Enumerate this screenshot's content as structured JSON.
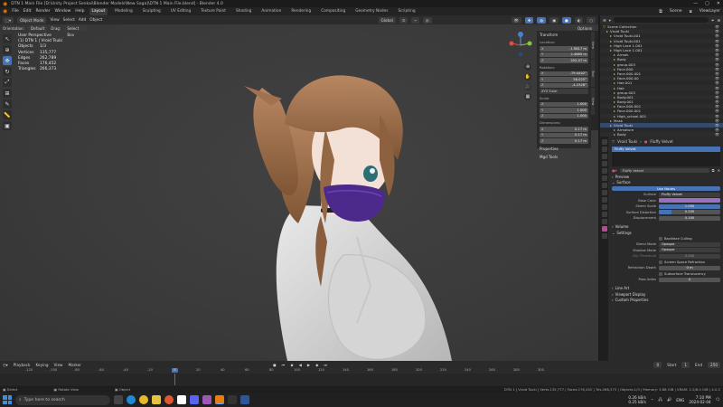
{
  "window": {
    "title": "DTN 1 Main File [D:\\Unity Project Senkai\\Blender Models\\New Saga]\\DTN 1 Main File.blend] - Blender 4.0"
  },
  "menubar": {
    "menus": [
      "File",
      "Edit",
      "Render",
      "Window",
      "Help"
    ],
    "workspaces": [
      "Layout",
      "Modeling",
      "Sculpting",
      "UV Editing",
      "Texture Paint",
      "Shading",
      "Animation",
      "Rendering",
      "Compositing",
      "Geometry Nodes",
      "Scripting"
    ],
    "active_workspace": "Layout",
    "scene_label": "Scene",
    "view_layer_label": "ViewLayer"
  },
  "viewport_header": {
    "mode": "Object Mode",
    "menus": [
      "View",
      "Select",
      "Add",
      "Object"
    ],
    "transform": "Global",
    "orientation_label": "Orientation:",
    "orientation_value": "Default",
    "drag_label": "Drag:",
    "drag_value": "Select Box",
    "options_label": "Options"
  },
  "viewport_overlay": {
    "view_name": "User Perspective",
    "collection": "(1) DTN 1 | Vroid Tsuki",
    "stats": [
      {
        "k": "Objects",
        "v": "1/3"
      },
      {
        "k": "Vertices",
        "v": "135,777"
      },
      {
        "k": "Edges",
        "v": "262,789"
      },
      {
        "k": "Faces",
        "v": "176,452"
      },
      {
        "k": "Triangles",
        "v": "266,373"
      }
    ]
  },
  "npanel": {
    "title": "Transform",
    "location_label": "Location:",
    "location": [
      {
        "ax": "X",
        "v": "-1.9817 m"
      },
      {
        "ax": "Y",
        "v": "2.4685 m"
      },
      {
        "ax": "Z",
        "v": "202.47 m"
      }
    ],
    "rotation_label": "Rotation:",
    "rotation": [
      {
        "ax": "X",
        "v": "-79.4442°"
      },
      {
        "ax": "Y",
        "v": "58.025°"
      },
      {
        "ax": "Z",
        "v": "-4.2328°"
      }
    ],
    "rotation_mode": "XYZ Euler",
    "scale_label": "Scale:",
    "scale": [
      {
        "ax": "X",
        "v": "1.000"
      },
      {
        "ax": "Y",
        "v": "1.000"
      },
      {
        "ax": "Z",
        "v": "1.000"
      }
    ],
    "dimensions_label": "Dimensions:",
    "dimensions": [
      {
        "ax": "X",
        "v": "0.17 m"
      },
      {
        "ax": "Y",
        "v": "0.17 m"
      },
      {
        "ax": "Z",
        "v": "0.17 m"
      }
    ],
    "properties_label": "Properties",
    "mmd_label": "Mgd Tools",
    "tabs": [
      "Item",
      "Tool",
      "View"
    ]
  },
  "outliner": {
    "search_placeholder": "",
    "rows": [
      {
        "icon": "▽",
        "label": "Scene Collection"
      },
      {
        "icon": "▸",
        "label": "Vroid Tsuki"
      },
      {
        "icon": "▸",
        "label": "Vroid Tsuki.001"
      },
      {
        "icon": "▸",
        "label": "Vroid Tsuki.001"
      },
      {
        "icon": "▸",
        "label": "High Lace 1.001"
      },
      {
        "icon": "▸",
        "label": "High Lace 1.001"
      },
      {
        "icon": "▸",
        "label": "Armat."
      },
      {
        "icon": "▸",
        "label": "Body"
      },
      {
        "icon": "▸",
        "label": "group.003"
      },
      {
        "icon": "▸",
        "label": "Face.000"
      },
      {
        "icon": "▸",
        "label": "Face.000.001"
      },
      {
        "icon": "▸",
        "label": "Face.000.00"
      },
      {
        "icon": "▸",
        "label": "Hair.001"
      },
      {
        "icon": "▸",
        "label": "Hair"
      },
      {
        "icon": "▸",
        "label": "group.003"
      },
      {
        "icon": "▸",
        "label": "Body.001"
      },
      {
        "icon": "▸",
        "label": "Body.001"
      },
      {
        "icon": "▸",
        "label": "Face.000.001"
      },
      {
        "icon": "▸",
        "label": "Face.000.001"
      },
      {
        "icon": "▸",
        "label": "High_school.001"
      },
      {
        "icon": "▸",
        "label": "Mask"
      },
      {
        "icon": "▸",
        "label": "Vroid Tsuki"
      },
      {
        "icon": "▸",
        "label": "Armature"
      },
      {
        "icon": "▸",
        "label": "Body"
      }
    ]
  },
  "properties": {
    "breadcrumb": [
      "Vroid Tsuki",
      "Fluffy Velvet"
    ],
    "slot": "Fluffy Velvet",
    "material_name": "Fluffy Velvet",
    "preview_label": "Preview",
    "surface_section": "Surface",
    "use_nodes": "Use Nodes",
    "surface_label": "Surface",
    "surface_value": "Fluffy Velvet",
    "fields": [
      {
        "l": "Base Color",
        "v": "",
        "color": "#9a6ec0"
      },
      {
        "l": "Sheen Scale",
        "v": "1.000",
        "fill": 1.0
      },
      {
        "l": "Surface Distortion",
        "v": "0.200",
        "fill": 0.2
      },
      {
        "l": "Displacement",
        "v": "0.100",
        "fill": 0.0
      }
    ],
    "volume_section": "Volume",
    "settings_section": "Settings",
    "backface_culling": "Backface Culling",
    "blend_mode_label": "Blend Mode",
    "blend_mode": "Opaque",
    "shadow_mode_label": "Shadow Mode",
    "shadow_mode": "Opaque",
    "clip_threshold_label": "Clip Threshold",
    "clip_threshold": "0.500",
    "screen_space": "Screen Space Refraction",
    "refraction_depth_label": "Refraction Depth",
    "refraction_depth": "0 m",
    "subsurface": "Subsurface Translucency",
    "pass_index_label": "Pass Index",
    "pass_index": "0",
    "line_art": "Line Art",
    "viewport_display": "Viewport Display",
    "custom_props": "Custom Properties"
  },
  "timeline": {
    "menus": [
      "Playback",
      "Keying",
      "View",
      "Marker"
    ],
    "current_frame": "0",
    "start_label": "Start",
    "start": "1",
    "end_label": "End",
    "end": "250",
    "ticks": [
      "-120",
      "-100",
      "-80",
      "-60",
      "-40",
      "-20",
      "0",
      "20",
      "40",
      "60",
      "80",
      "100",
      "120",
      "140",
      "160",
      "180",
      "200",
      "220",
      "240",
      "260",
      "280",
      "300"
    ]
  },
  "statusbar": {
    "left": "Select",
    "middle": "Rotate View",
    "center": "Object",
    "right": "DTN 1 | Vroid Tsuki | Verts:135,777 | Faces:176,452 | Tris:266,373 | Objects:1/3 | Memory: 3.88 GiB | VRAM: 2.2/8.0 GiB | 4.0.2"
  },
  "taskbar": {
    "search_placeholder": "Type here to search",
    "net_up": "0.26 kB/s",
    "net_down": "0.25 kB/s",
    "time": "7:10 PM",
    "date": "2024-02-04",
    "lang": "ENG"
  }
}
